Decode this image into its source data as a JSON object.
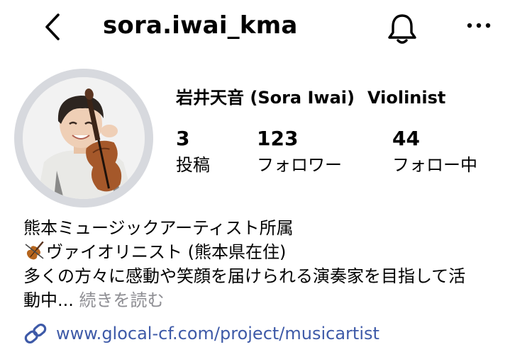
{
  "header": {
    "username": "sora.iwai_kma",
    "back_icon": "chevron-left-icon",
    "bell_icon": "bell-icon",
    "more_icon": "more-horizontal-icon"
  },
  "profile": {
    "name": "岩井天音 (Sora Iwai)",
    "category": "Violinist",
    "stats": [
      {
        "value": "3",
        "label": "投稿"
      },
      {
        "value": "123",
        "label": "フォロワー"
      },
      {
        "value": "44",
        "label": "フォロー中"
      }
    ],
    "avatar_alt": "avatar"
  },
  "bio": {
    "line1": "熊本ミュージックアーティスト所属",
    "line2_emoji": "violin-emoji",
    "line2": "ヴァイオリニスト (熊本県在住)",
    "line3": "多くの方々に感動や笑顔を届けられる演奏家を目指して活",
    "line4": "動中...",
    "more_label": "続きを読む"
  },
  "link": {
    "icon": "link-icon",
    "url": "www.glocal-cf.com/project/musicartist"
  },
  "colors": {
    "link": "#3e5aa8",
    "muted": "#8e8e93",
    "ring": "#d7d9de"
  }
}
